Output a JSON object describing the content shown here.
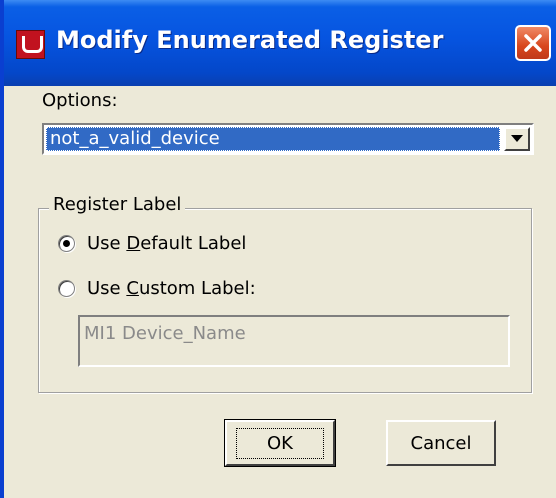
{
  "window": {
    "title": "Modify Enumerated Register"
  },
  "icons": {
    "app": "app-icon",
    "close": "close-icon",
    "dropdown": "chevron-down-icon"
  },
  "options": {
    "label": "Options:",
    "selected_value": "not_a_valid_device"
  },
  "register_label": {
    "legend": "Register Label",
    "default_radio": {
      "prefix": "Use ",
      "accel": "D",
      "suffix": "efault Label",
      "checked": true
    },
    "custom_radio": {
      "prefix": "Use ",
      "accel": "C",
      "suffix": "ustom Label:",
      "checked": false
    },
    "custom_field_value": "MI1 Device_Name"
  },
  "buttons": {
    "ok": "OK",
    "cancel": "Cancel"
  },
  "colors": {
    "titlebar": "#0654e0",
    "selection": "#316ac5",
    "close": "#d8461c",
    "app_icon": "#c1121f"
  }
}
